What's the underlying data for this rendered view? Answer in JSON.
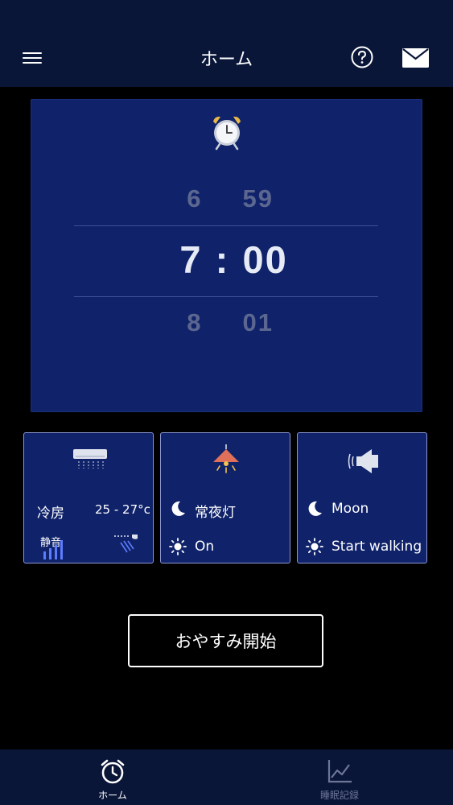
{
  "header": {
    "title": "ホーム"
  },
  "alarm": {
    "prev": {
      "hour": "6",
      "minute": "59"
    },
    "current": {
      "hour": "7",
      "separator": ":",
      "minute": "00"
    },
    "next": {
      "hour": "8",
      "minute": "01"
    }
  },
  "tiles": {
    "aircon": {
      "mode": "冷房",
      "temp_range": "25 - 27°c",
      "fan_label": "静音"
    },
    "night_light": {
      "night_setting": "常夜灯",
      "day_setting": "On"
    },
    "sound": {
      "night_setting": "Moon",
      "day_setting": "Start walking"
    }
  },
  "sleep_button": {
    "label": "おやすみ開始"
  },
  "tabbar": {
    "tabs": [
      {
        "label": "ホーム",
        "active": true
      },
      {
        "label": "睡眠記録",
        "active": false
      }
    ]
  },
  "colors": {
    "header_bg": "#0a1638",
    "panel_bg": "#10236a",
    "tile_border": "#8c96d2",
    "inactive_tab": "#6d7697",
    "alarm_bell": "#e8b84a",
    "lamp": "#e0705a"
  },
  "icons": {
    "menu": "hamburger-icon",
    "help": "question-circle-icon",
    "mail": "envelope-icon",
    "alarm": "alarm-clock-icon",
    "aircon": "air-conditioner-icon",
    "lamp": "ceiling-lamp-icon",
    "sound": "speaker-icon",
    "night": "moon-icon",
    "day": "sun-icon",
    "home_tab": "alarm-clock-icon",
    "record_tab": "line-chart-icon"
  }
}
